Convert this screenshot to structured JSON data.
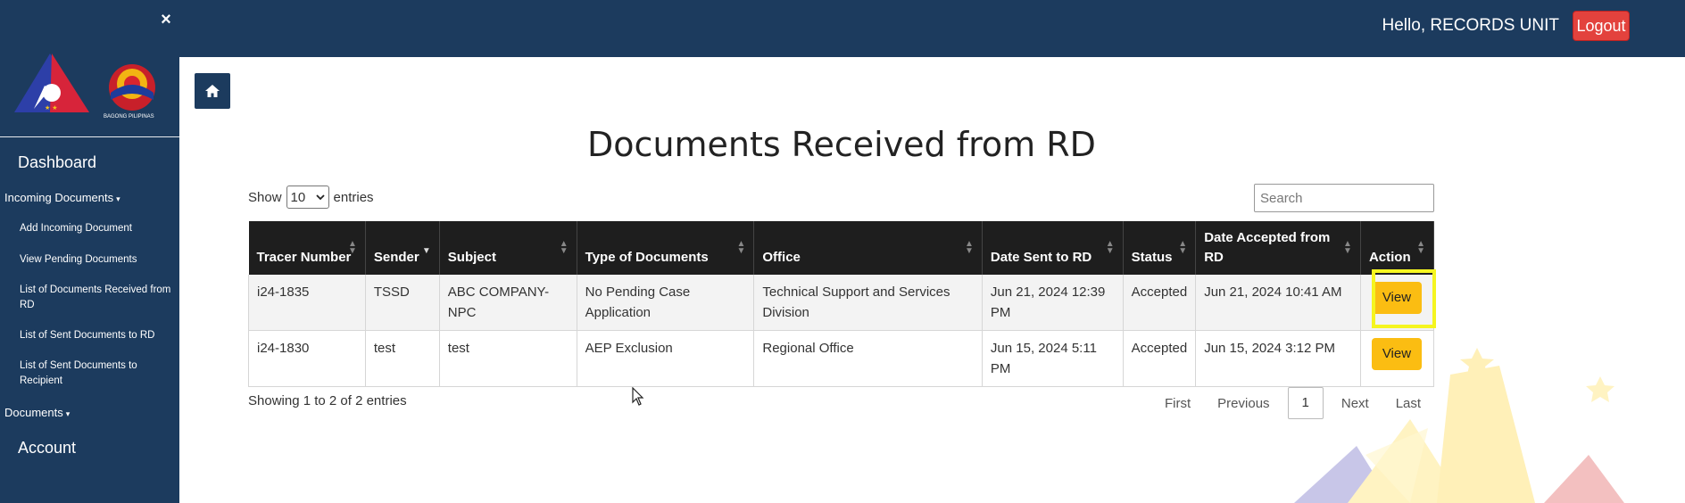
{
  "sidebar": {
    "close_glyph": "×",
    "dashboard": "Dashboard",
    "incoming": "Incoming Documents",
    "incoming_items": [
      "Add Incoming Document",
      "View Pending Documents",
      "List of Documents Received from RD",
      "List of Sent Documents to RD",
      "List of Sent Documents to Recipient"
    ],
    "documents": "Documents",
    "account": "Account",
    "caret": "▾",
    "logo_caption": "BAGONG PILIPINAS"
  },
  "topbar": {
    "greeting": "Hello, RECORDS UNIT",
    "logout": "Logout"
  },
  "page": {
    "title": "Documents Received from RD",
    "show_label": "Show",
    "entries_label": "entries",
    "page_length": "10",
    "search_placeholder": "Search",
    "showing_text": "Showing 1 to 2 of 2 entries"
  },
  "table": {
    "columns": [
      "Tracer Number",
      "Sender",
      "Subject",
      "Type of Documents",
      "Office",
      "Date Sent to RD",
      "Status",
      "Date Accepted from RD",
      "Action"
    ],
    "rows": [
      {
        "tracer": "i24-1835",
        "sender": "TSSD",
        "subject": "ABC COMPANY-NPC",
        "type": "No Pending Case Application",
        "office": "Technical Support and Services Division",
        "date_sent": "Jun 21, 2024 12:39 PM",
        "status": "Accepted",
        "date_accepted": "Jun 21, 2024 10:41 AM",
        "action": "View"
      },
      {
        "tracer": "i24-1830",
        "sender": "test",
        "subject": "test",
        "type": "AEP Exclusion",
        "office": "Regional Office",
        "date_sent": "Jun 15, 2024 5:11 PM",
        "status": "Accepted",
        "date_accepted": "Jun 15, 2024 3:12 PM",
        "action": "View"
      }
    ]
  },
  "pager": {
    "first": "First",
    "previous": "Previous",
    "current": "1",
    "next": "Next",
    "last": "Last"
  },
  "colors": {
    "navy": "#1c3b5e",
    "logout_red": "#e3423d",
    "view_yellow": "#fbbd12",
    "highlight": "#f5f51f",
    "header_black": "#1e1e1e"
  }
}
